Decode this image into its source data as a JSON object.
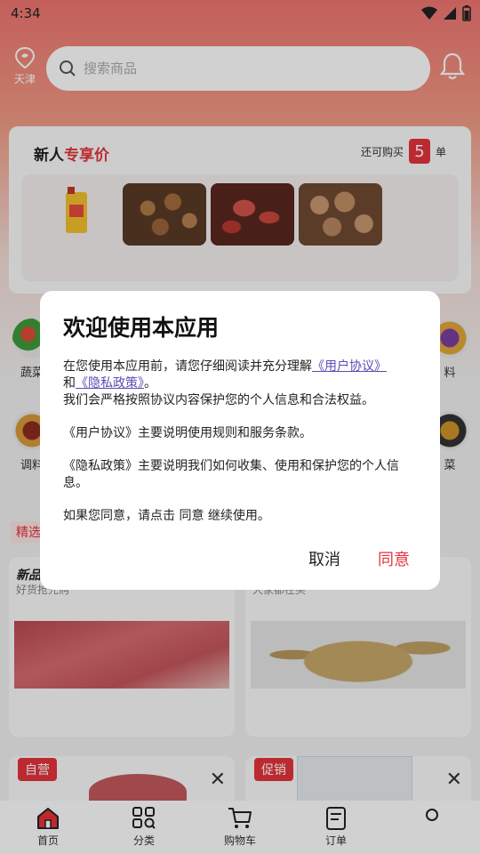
{
  "status_bar": {
    "time": "4:34"
  },
  "header": {
    "location": "天津",
    "search_placeholder": "搜索商品"
  },
  "new_user": {
    "title_prefix": "新人",
    "title_accent": "专享价",
    "remain_prefix": "还可购买",
    "remain_count": "5",
    "remain_suffix": "单"
  },
  "categories": {
    "left_top": "蔬菜",
    "right_top": "料",
    "left_bottom": "调料",
    "right_bottom": "菜"
  },
  "section_tag": "精选",
  "product_cards": [
    {
      "title": "新品",
      "subtitle": "好货抢先购"
    },
    {
      "title": "",
      "subtitle": "大家都在买"
    }
  ],
  "ad_cards": [
    {
      "tag": "自营"
    },
    {
      "tag": "促销"
    }
  ],
  "bottom_nav": [
    {
      "label": "首页",
      "icon": "home-icon"
    },
    {
      "label": "分类",
      "icon": "grid-search-icon"
    },
    {
      "label": "购物车",
      "icon": "cart-icon"
    },
    {
      "label": "订单",
      "icon": "order-icon"
    }
  ],
  "dialog": {
    "title": "欢迎使用本应用",
    "intro_text": "在您使用本应用前，请您仔细阅读并充分理解",
    "user_agreement_link": "《用户协议》",
    "and_text": "和",
    "privacy_link": "《隐私政策》",
    "period": "。",
    "promise_text": "我们会严格按照协议内容保护您的个人信息和合法权益。",
    "user_agreement_desc": "《用户协议》主要说明使用规则和服务条款。",
    "privacy_desc": "《隐私政策》主要说明我们如何收集、使用和保护您的个人信息。",
    "consent_text": "如果您同意，请点击 同意 继续使用。",
    "cancel_label": "取消",
    "agree_label": "同意"
  }
}
